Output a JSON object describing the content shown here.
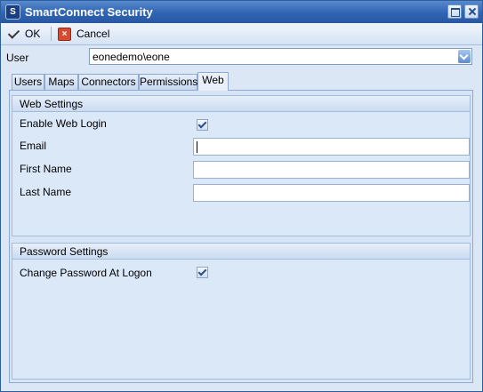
{
  "window": {
    "title": "SmartConnect Security",
    "icon": "smartconnect-app-icon"
  },
  "toolbar": {
    "ok_label": "OK",
    "cancel_label": "Cancel"
  },
  "user": {
    "label": "User",
    "value": "eonedemo\\eone"
  },
  "tabs": [
    {
      "label": "Users"
    },
    {
      "label": "Maps"
    },
    {
      "label": "Connectors"
    },
    {
      "label": "Permissions"
    },
    {
      "label": "Web"
    }
  ],
  "active_tab": "Web",
  "web_settings": {
    "title": "Web Settings",
    "enable_web_login_label": "Enable Web Login",
    "enable_web_login_checked": true,
    "email_label": "Email",
    "email_value": "",
    "first_name_label": "First Name",
    "first_name_value": "",
    "last_name_label": "Last Name",
    "last_name_value": ""
  },
  "password_settings": {
    "title": "Password Settings",
    "change_password_label": "Change Password At Logon",
    "change_password_checked": true
  },
  "colors": {
    "titlebar": "#2f64b3",
    "window_bg": "#dce7f5",
    "border": "#8eaad2"
  }
}
